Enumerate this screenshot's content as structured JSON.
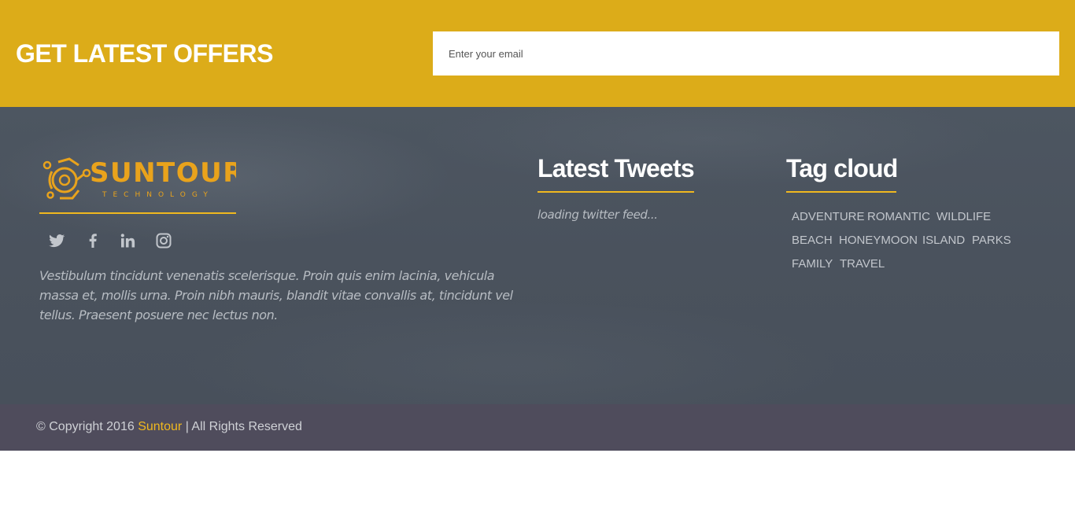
{
  "newsletter": {
    "title": "GET LATEST OFFERS",
    "email_placeholder": "Enter your email",
    "background_color": "#dcac19"
  },
  "brand": {
    "name": "SUNTOUR",
    "tagline": "TECHNOLOGY",
    "accent_color": "#f0b81f"
  },
  "social": [
    {
      "icon": "twitter-icon"
    },
    {
      "icon": "facebook-icon"
    },
    {
      "icon": "linkedin-icon"
    },
    {
      "icon": "instagram-icon"
    }
  ],
  "about": {
    "text": "Vestibulum tincidunt venenatis scelerisque. Proin quis enim lacinia, vehicula massa et, mollis urna. Proin nibh mauris, blandit vitae convallis at, tincidunt vel tellus. Praesent posuere nec lectus non."
  },
  "tweets": {
    "title": "Latest Tweets",
    "loading": "loading twitter feed..."
  },
  "tags": {
    "title": "Tag cloud",
    "items": [
      "ADVENTURE",
      "ROMANTIC",
      "WILDLIFE",
      "BEACH",
      "HONEYMOON",
      "ISLAND",
      "PARKS",
      "FAMILY",
      "TRAVEL"
    ]
  },
  "copyright": {
    "prefix": "© Copyright 2016 ",
    "brand": "Suntour",
    "suffix": " | All Rights Reserved"
  }
}
